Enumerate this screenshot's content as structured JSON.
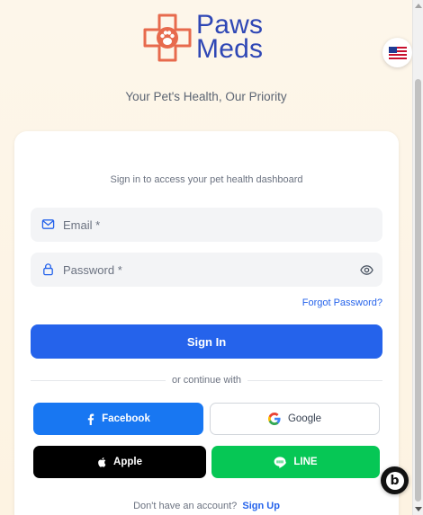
{
  "brand": {
    "name_line1": "Paws",
    "name_line2": "Meds",
    "tagline": "Your Pet's Health, Our Priority",
    "color": "#2f47b5",
    "mark_color": "#e76a4d"
  },
  "language": {
    "icon": "us-flag-icon"
  },
  "login": {
    "subtitle": "Sign in to access your pet health dashboard",
    "email_placeholder": "Email *",
    "email_value": "",
    "password_placeholder": "Password *",
    "password_value": "",
    "forgot_label": "Forgot Password?",
    "signin_label": "Sign In",
    "divider_text": "or continue with",
    "signup_prompt": "Don't have an account?",
    "signup_label": "Sign Up",
    "primary_color": "#2563eb"
  },
  "social": {
    "facebook": {
      "label": "Facebook",
      "color": "#1877f2"
    },
    "google": {
      "label": "Google",
      "color": "#ffffff"
    },
    "apple": {
      "label": "Apple",
      "color": "#000000"
    },
    "line": {
      "label": "LINE",
      "color": "#06c755"
    }
  },
  "floating_badge": {
    "glyph": "b",
    "icon": "assistant-badge-icon"
  }
}
